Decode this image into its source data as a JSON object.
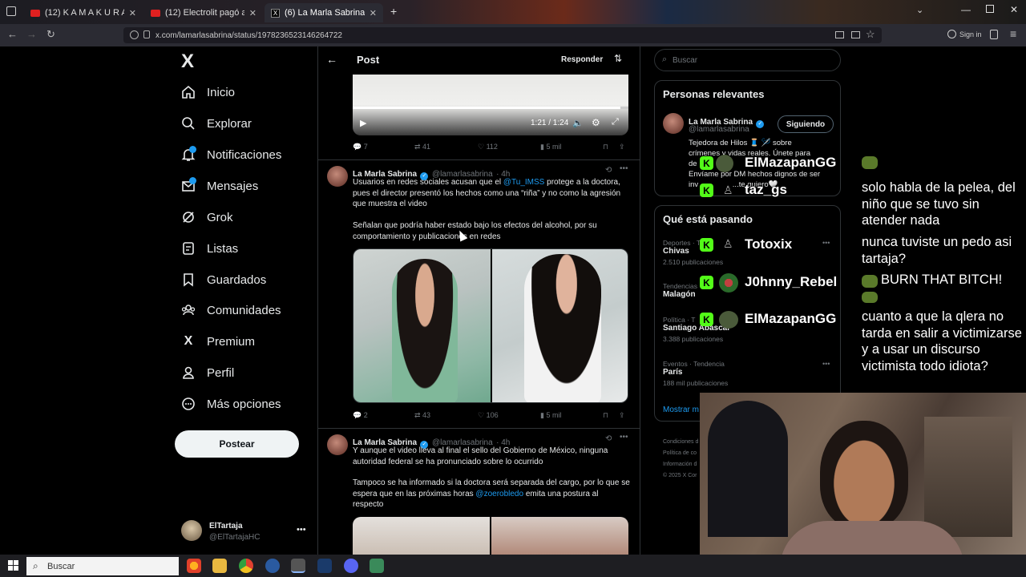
{
  "browser": {
    "tabs": [
      {
        "label": "(12) K A M A K U R A  1980 -"
      },
      {
        "label": "(12) Electrolit pagó a Mr Docto"
      },
      {
        "label": "(6) La Marla Sabrina en X: \"Al la"
      }
    ],
    "url": "x.com/lamarlasabrina/status/1978236523146264722",
    "signin": "Sign in"
  },
  "sidebar": {
    "logo": "X",
    "items": [
      {
        "label": "Inicio"
      },
      {
        "label": "Explorar"
      },
      {
        "label": "Notificaciones"
      },
      {
        "label": "Mensajes"
      },
      {
        "label": "Grok"
      },
      {
        "label": "Listas"
      },
      {
        "label": "Guardados"
      },
      {
        "label": "Comunidades"
      },
      {
        "label": "Premium"
      },
      {
        "label": "Perfil"
      },
      {
        "label": "Más opciones"
      }
    ],
    "post_button": "Postear",
    "account": {
      "name": "ElTartaja",
      "handle": "@ElTartajaHC"
    }
  },
  "header": {
    "title": "Post",
    "reply": "Responder"
  },
  "video": {
    "time": "1:21 / 1:24"
  },
  "tweet0_stats": {
    "replies": "7",
    "reposts": "41",
    "likes": "112",
    "views": "5 mil"
  },
  "tweets": [
    {
      "name": "La Marla Sabrina",
      "handle": "@lamarlasabrina",
      "time": "· 4h",
      "p1_a": "Usuarios en redes sociales acusan que el ",
      "p1_link": "@Tu_IMSS",
      "p1_b": " protege a la doctora, pues el director presentó los hechos como una “riña” y no como la agresión que muestra el video",
      "p2": "Señalan que podría haber estado bajo los efectos del alcohol, por su comportamiento y publicaciones en redes",
      "replies": "2",
      "reposts": "43",
      "likes": "106",
      "views": "5 mil"
    },
    {
      "name": "La Marla Sabrina",
      "handle": "@lamarlasabrina",
      "time": "· 4h",
      "p1": "Y aunque el video lleva al final el sello del Gobierno de México, ninguna autoridad federal se ha pronunciado sobre lo ocurrido",
      "p2_a": "Tampoco se ha informado si la doctora será separada del cargo, por lo que se espera que en las próximas horas ",
      "p2_link": "@zoerobledo",
      "p2_b": " emita una postura al respecto"
    }
  ],
  "search": {
    "placeholder": "Buscar"
  },
  "relevant": {
    "title": "Personas relevantes",
    "name": "La Marla Sabrina",
    "handle": "@lamarlasabrina",
    "button": "Siguiendo",
    "bio_l1": "Tejedora de Hilos 🧵 🪡 sobre",
    "bio_l2": "crímenes y vidas reales. Únete para",
    "bio_l3": "de",
    "bio_l4": "Envíame por DM hechos dignos de ser",
    "bio_l5": "inv",
    "bio_l5b": "...te quiero🤍"
  },
  "trending": {
    "title": "Qué está pasando",
    "items": [
      {
        "cat": "Deportes · T",
        "name": "Chivas",
        "count": "2.510 publicaciones"
      },
      {
        "cat": "Tendencias",
        "name": "Malagón",
        "count": ""
      },
      {
        "cat": "Política · T",
        "name": "Santiago Abascal",
        "count": "3.388 publicaciones"
      },
      {
        "cat": "Eventos · Tendencia",
        "name": "París",
        "count": "188 mil publicaciones"
      }
    ],
    "show_more": "Mostrar m"
  },
  "footer": {
    "l1": "Condiciones d",
    "l2": "Política de co",
    "l3": "Información d",
    "l4": "© 2025 X Cor"
  },
  "chat": [
    {
      "user": "ElMazapanGG",
      "message": "solo habla de la pelea, del niño que se tuvo sin atender nada"
    },
    {
      "user": "taz_gs",
      "message": ""
    },
    {
      "user": "Totoxix",
      "message": "nunca tuviste un pedo asi tartaja?"
    },
    {
      "user": "J0hnny_Rebel",
      "message": "BURN THAT BITCH!"
    },
    {
      "user": "ElMazapanGG",
      "message": "cuanto a que la qlera no tarda en salir a victimizarse y a usar un discurso victimista todo idiota?"
    }
  ],
  "taskbar": {
    "search": "Buscar"
  }
}
